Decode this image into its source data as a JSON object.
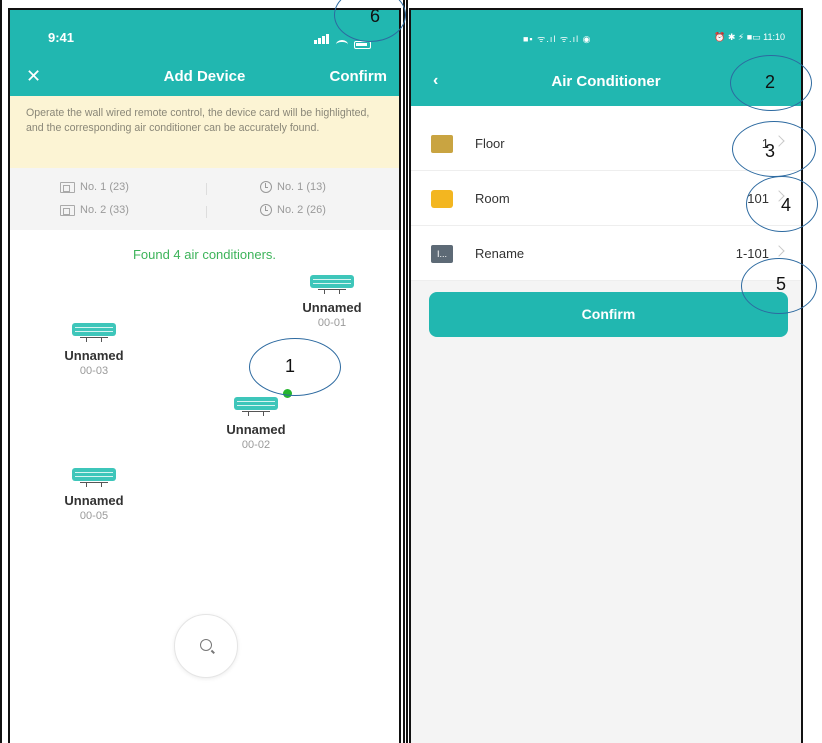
{
  "colors": {
    "accent": "#21b7b0",
    "tip_bg": "#fcf4d4",
    "found_green": "#3db35a",
    "online_dot": "#25b52e"
  },
  "left_screen": {
    "status": {
      "time": "9:41"
    },
    "nav": {
      "close_icon": "close-icon",
      "title": "Add Device",
      "confirm_label": "Confirm"
    },
    "tip_text": "Operate the wall wired remote control, the device card will be highlighted, and the corresponding air conditioner can be accurately found.",
    "counts": [
      {
        "icon": "panel-icon",
        "label": "No. 1 (23)"
      },
      {
        "icon": "clock-icon",
        "label": "No. 1 (13)"
      },
      {
        "icon": "panel-icon",
        "label": "No. 2 (33)"
      },
      {
        "icon": "clock-icon",
        "label": "No. 2 (26)"
      }
    ],
    "found_text": "Found 4 air conditioners.",
    "devices": [
      {
        "name": "Unnamed",
        "code": "00-01"
      },
      {
        "name": "Unnamed",
        "code": "00-03"
      },
      {
        "name": "Unnamed",
        "code": "00-02"
      },
      {
        "name": "Unnamed",
        "code": "00-05"
      }
    ],
    "search_icon": "search-icon"
  },
  "right_screen": {
    "status": {
      "left": "■▪ ᯤ.ıl ᯤ.ıl ◉",
      "right": "⏰ ✱ ⚡ ■▭ 11:10"
    },
    "nav": {
      "back_icon": "back-chevron-icon",
      "title": "Air Conditioner"
    },
    "rows": [
      {
        "icon": "building-icon",
        "label": "Floor",
        "value": "1"
      },
      {
        "icon": "door-icon",
        "label": "Room",
        "value": "101"
      },
      {
        "icon": "rename-icon",
        "icon_text": "I...",
        "label": "Rename",
        "value": "1-101"
      }
    ],
    "confirm_label": "Confirm"
  },
  "annotations": [
    "1",
    "2",
    "3",
    "4",
    "5",
    "6"
  ]
}
